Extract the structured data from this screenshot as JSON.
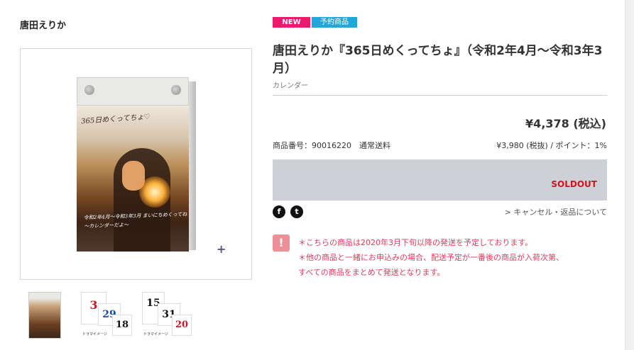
{
  "artist": "唐田えりか",
  "badges": {
    "new": "NEW",
    "preorder": "予約商品"
  },
  "product": {
    "title": "唐田えりか『365日めくってちょ』（令和2年4月～令和3年3月）",
    "category": "カレンダー",
    "price": "¥4,378 (税込)",
    "code_line": "商品番号：90016220　通常送料",
    "sub_price": "¥3,980 (税抜) / ポイント：1%",
    "status": "SOLDOUT"
  },
  "image": {
    "cover_title": "365日めくってちょ♡",
    "cover_caption": "令和2年4月〜令和3年3月 まいにちめくってね 〜カレンダーだよ〜",
    "zoom_icon": "plus-icon"
  },
  "thumbnails": {
    "t2": {
      "n1": "3",
      "n2": "29",
      "n3": "18",
      "caption": "ドラマイメージ"
    },
    "t3": {
      "n1": "15",
      "n2": "31",
      "n3": "20",
      "caption": "ドラマイメージ"
    }
  },
  "social": {
    "facebook": "f",
    "twitter": "t"
  },
  "links": {
    "cancel": "> キャンセル・返品について"
  },
  "notice": {
    "icon": "!",
    "lines": [
      "＊こちらの商品は2020年3月下旬以降の発送を予定しております。",
      "＊他の商品と一緒にお申込みの場合、配送予定が一番後の商品が入荷次第、",
      "すべての商品をまとめて発送となります。"
    ]
  },
  "colors": {
    "new_badge": "#ee1a6d",
    "preorder_badge": "#21a7dc",
    "soldout_bg": "#cdd0d6",
    "soldout_text": "#d0141e",
    "notice_text": "#e23b5b"
  }
}
